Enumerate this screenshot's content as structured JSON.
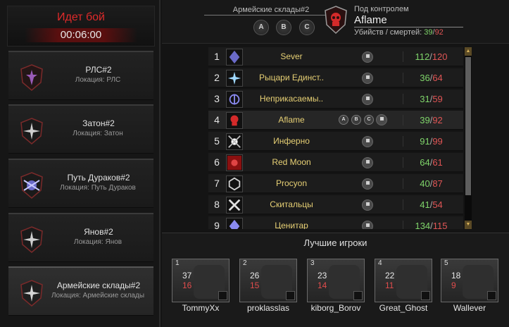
{
  "battle": {
    "title": "Идет бой",
    "timer": "00:06:00"
  },
  "zones": [
    {
      "name": "РЛС#2",
      "location": "Локация: РЛС"
    },
    {
      "name": "Затон#2",
      "location": "Локация: Затон"
    },
    {
      "name": "Путь Дураков#2",
      "location": "Локация: Путь Дураков"
    },
    {
      "name": "Янов#2",
      "location": "Локация: Янов"
    },
    {
      "name": "Армейские склады#2",
      "location": "Локация: Армейские склады"
    }
  ],
  "header": {
    "zone_name": "Армейские склады#2",
    "points": [
      "A",
      "B",
      "C"
    ],
    "control_label": "Под контролем",
    "controller": "Aflame",
    "kd_label": "Убийств / смертей:",
    "kills": "39",
    "deaths": "92"
  },
  "standings": [
    {
      "rank": "1",
      "clan": "Sever",
      "points": [],
      "kills": "112",
      "deaths": "120"
    },
    {
      "rank": "2",
      "clan": "Рыцари Единст..",
      "points": [],
      "kills": "36",
      "deaths": "64"
    },
    {
      "rank": "3",
      "clan": "Неприкасаемы..",
      "points": [],
      "kills": "31",
      "deaths": "59"
    },
    {
      "rank": "4",
      "clan": "Aflame",
      "points": [
        "A",
        "B",
        "C"
      ],
      "kills": "39",
      "deaths": "92"
    },
    {
      "rank": "5",
      "clan": "Инферно",
      "points": [],
      "kills": "91",
      "deaths": "99"
    },
    {
      "rank": "6",
      "clan": "Red Moon",
      "points": [],
      "kills": "64",
      "deaths": "61"
    },
    {
      "rank": "7",
      "clan": "Procyon",
      "points": [],
      "kills": "40",
      "deaths": "87"
    },
    {
      "rank": "8",
      "clan": "Скитальцы",
      "points": [],
      "kills": "41",
      "deaths": "54"
    },
    {
      "rank": "9",
      "clan": "Ценитар",
      "points": [],
      "kills": "134",
      "deaths": "115"
    }
  ],
  "best_players": {
    "title": "Лучшие игроки",
    "players": [
      {
        "rank": "1",
        "name": "TommyXx",
        "kills": "37",
        "deaths": "16"
      },
      {
        "rank": "2",
        "name": "proklasslas",
        "kills": "26",
        "deaths": "15"
      },
      {
        "rank": "3",
        "name": "kiborg_Borov",
        "kills": "23",
        "deaths": "14"
      },
      {
        "rank": "4",
        "name": "Great_Ghost",
        "kills": "22",
        "deaths": "11"
      },
      {
        "rank": "5",
        "name": "Wallever",
        "kills": "18",
        "deaths": "9"
      }
    ]
  },
  "colors": {
    "accent_red": "#e02a2a",
    "clan_gold": "#e6cf74",
    "kills_green": "#7fd46a",
    "deaths_red": "#e05555"
  },
  "icons": {
    "zone_emblem": "shield-emblem-icon",
    "capture_flag": "flag-icon"
  }
}
